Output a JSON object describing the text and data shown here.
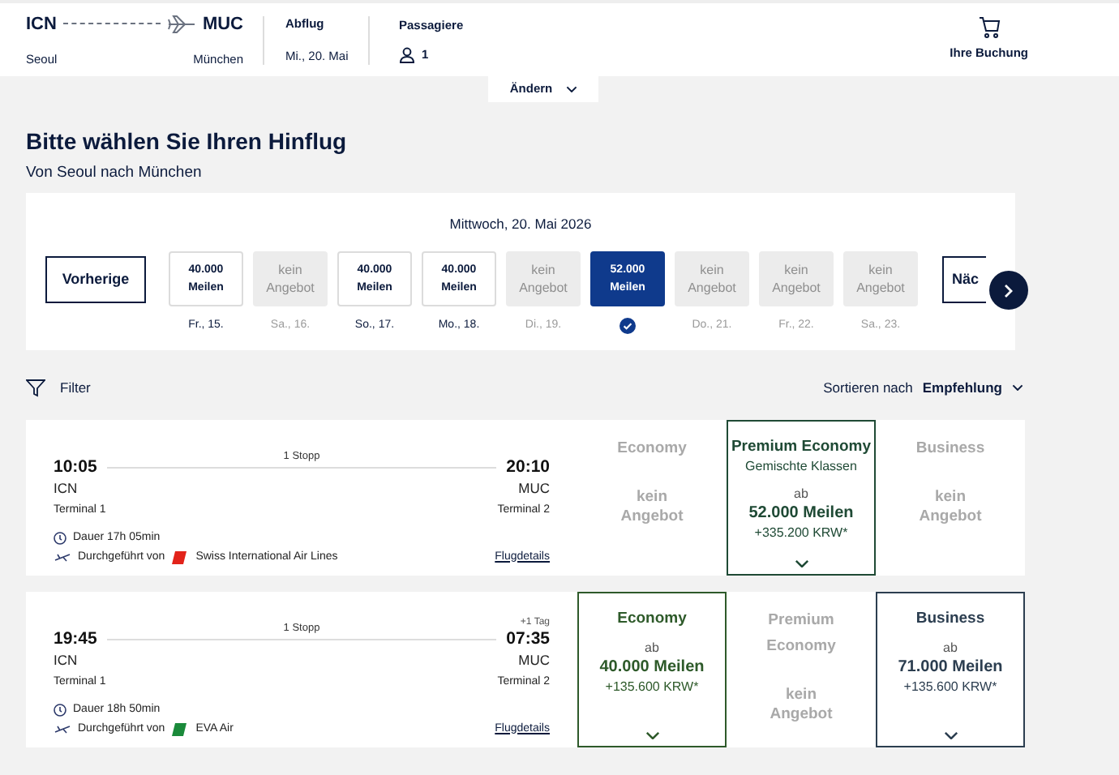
{
  "header": {
    "origin": {
      "code": "ICN",
      "city": "Seoul"
    },
    "destination": {
      "code": "MUC",
      "city": "München"
    },
    "departure": {
      "label": "Abflug",
      "value": "Mi., 20. Mai"
    },
    "passengers": {
      "label": "Passagiere",
      "value": "1"
    },
    "booking": {
      "label": "Ihre Buchung"
    },
    "change": {
      "label": "Ändern"
    }
  },
  "title": "Bitte wählen Sie Ihren Hinflug",
  "subtitle": "Von Seoul nach München",
  "calendar": {
    "heading": "Mittwoch, 20. Mai 2026",
    "previous": "Vorherige",
    "next": "Näc",
    "days": [
      {
        "kind": "price",
        "price": "40.000",
        "unit": "Meilen",
        "date": "Fr., 15.",
        "selected": false
      },
      {
        "kind": "none",
        "label": "kein Angebot",
        "date": "Sa., 16.",
        "selected": false
      },
      {
        "kind": "price",
        "price": "40.000",
        "unit": "Meilen",
        "date": "So., 17.",
        "selected": false
      },
      {
        "kind": "price",
        "price": "40.000",
        "unit": "Meilen",
        "date": "Mo., 18.",
        "selected": false
      },
      {
        "kind": "none",
        "label": "kein Angebot",
        "date": "Di., 19.",
        "selected": false
      },
      {
        "kind": "price",
        "price": "52.000",
        "unit": "Meilen",
        "selected": true
      },
      {
        "kind": "none",
        "label": "kein Angebot",
        "date": "Do., 21.",
        "selected": false
      },
      {
        "kind": "none",
        "label": "kein Angebot",
        "date": "Fr., 22.",
        "selected": false
      },
      {
        "kind": "none",
        "label": "kein Angebot",
        "date": "Sa., 23.",
        "selected": false
      }
    ]
  },
  "toolbar": {
    "filter": "Filter",
    "sort_label": "Sortieren nach",
    "sort_value": "Empfehlung"
  },
  "flights": [
    {
      "stops": "1 Stopp",
      "dep_time": "10:05",
      "dep_code": "ICN",
      "dep_terminal": "Terminal 1",
      "arr_time": "20:10",
      "arr_code": "MUC",
      "arr_terminal": "Terminal 2",
      "duration": "Dauer 17h 05min",
      "operated_by": "Durchgeführt von",
      "airline": "Swiss International Air Lines",
      "color": "#e2231a",
      "details": "Flugdetails",
      "fares": [
        {
          "kind": "none",
          "cabin": "Economy",
          "label": "kein Angebot"
        },
        {
          "kind": "offer",
          "cabin": "Premium Economy",
          "note": "Gemischte Klassen",
          "from": "ab",
          "miles": "52.000 Meilen",
          "tax": "+335.200 KRW*",
          "color": "#1f4a35"
        },
        {
          "kind": "none",
          "cabin": "Business",
          "label": "kein Angebot"
        }
      ]
    },
    {
      "stops": "1 Stopp",
      "dep_time": "19:45",
      "dep_code": "ICN",
      "dep_terminal": "Terminal 1",
      "day_offset": "+1 Tag",
      "arr_time": "07:35",
      "arr_code": "MUC",
      "arr_terminal": "Terminal 2",
      "duration": "Dauer 18h 50min",
      "operated_by": "Durchgeführt von",
      "airline": "EVA Air",
      "color": "#1a8a3a",
      "details": "Flugdetails",
      "fares": [
        {
          "kind": "offer",
          "cabin": "Economy",
          "from": "ab",
          "miles": "40.000 Meilen",
          "tax": "+135.600 KRW*",
          "color": "#2e5a2a"
        },
        {
          "kind": "none",
          "cabin": "Premium Economy",
          "label": "kein Angebot"
        },
        {
          "kind": "offer",
          "cabin": "Business",
          "from": "ab",
          "miles": "71.000 Meilen",
          "tax": "+135.600 KRW*",
          "color": "#2c3e50"
        }
      ]
    }
  ]
}
